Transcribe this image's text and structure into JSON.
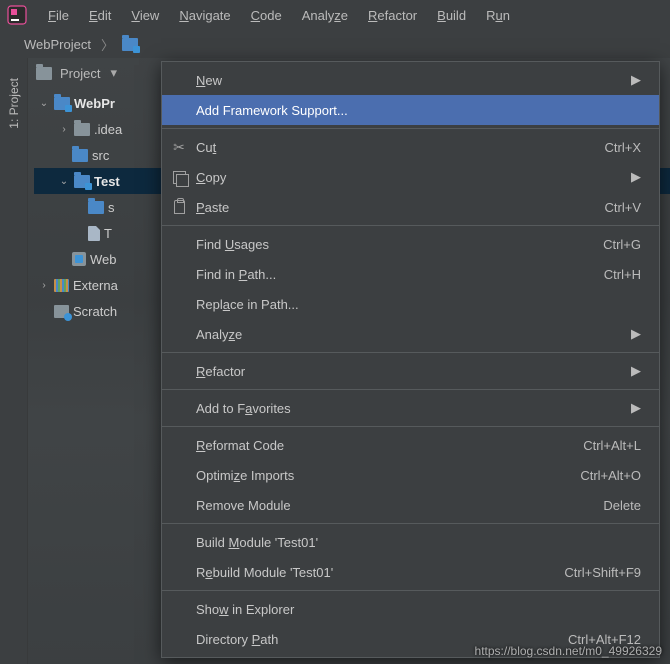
{
  "menubar": {
    "items": [
      "File",
      "Edit",
      "View",
      "Navigate",
      "Code",
      "Analyze",
      "Refactor",
      "Build",
      "Run"
    ],
    "underlines": [
      0,
      0,
      0,
      0,
      0,
      5,
      0,
      0,
      0
    ]
  },
  "breadcrumb": {
    "root": "WebProject"
  },
  "rail": {
    "label": "1: Project"
  },
  "panel": {
    "title": "Project"
  },
  "tree": {
    "root": "WebPr",
    "idea": ".idea",
    "src": "src",
    "test": "Test",
    "test_s": "s",
    "test_t": "T",
    "web_iml": "Web",
    "external": "Externa",
    "scratch": "Scratch"
  },
  "context": {
    "new": "New",
    "afs": "Add Framework Support...",
    "cut": {
      "label": "Cut",
      "shortcut": "Ctrl+X"
    },
    "copy": {
      "label": "Copy"
    },
    "paste": {
      "label": "Paste",
      "shortcut": "Ctrl+V"
    },
    "findUsages": {
      "label": "Find Usages",
      "shortcut": "Ctrl+G"
    },
    "findInPath": {
      "label": "Find in Path...",
      "shortcut": "Ctrl+H"
    },
    "replaceInPath": "Replace in Path...",
    "analyze": "Analyze",
    "refactor": "Refactor",
    "favorites": "Add to Favorites",
    "reformat": {
      "label": "Reformat Code",
      "shortcut": "Ctrl+Alt+L"
    },
    "optimize": {
      "label": "Optimize Imports",
      "shortcut": "Ctrl+Alt+O"
    },
    "removeModule": {
      "label": "Remove Module",
      "shortcut": "Delete"
    },
    "buildModule": "Build Module 'Test01'",
    "rebuildModule": {
      "label": "Rebuild Module 'Test01'",
      "shortcut": "Ctrl+Shift+F9"
    },
    "showExplorer": "Show in Explorer",
    "directoryPath": {
      "label": "Directory Path",
      "shortcut": "Ctrl+Alt+F12"
    }
  },
  "watermark": "https://blog.csdn.net/m0_49926329"
}
